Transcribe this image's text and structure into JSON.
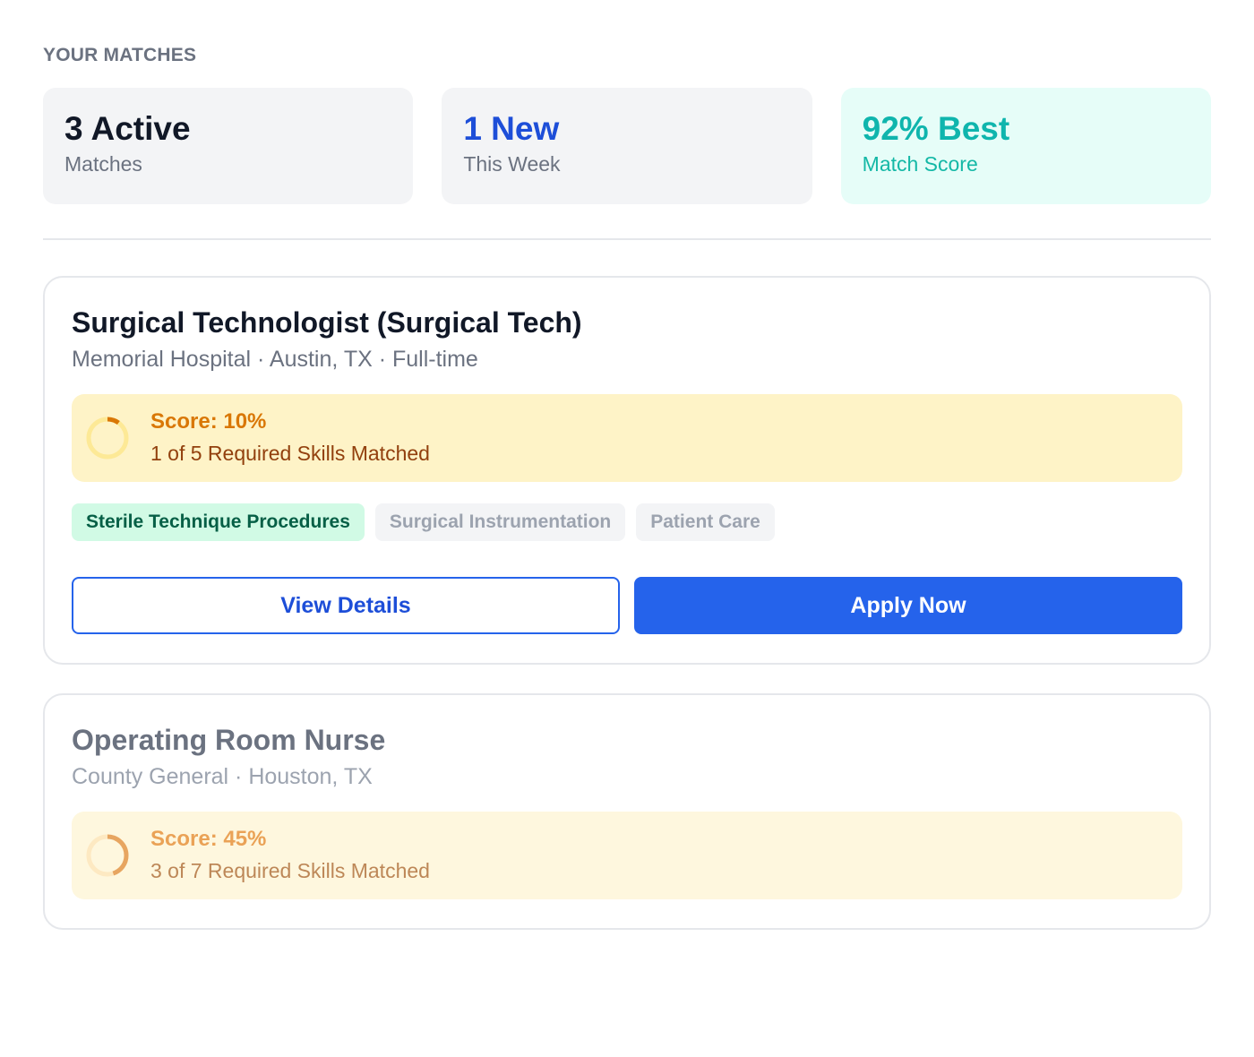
{
  "section_title": "YOUR MATCHES",
  "stats": [
    {
      "value": "3 Active",
      "label": "Matches"
    },
    {
      "value": "1 New",
      "label": "This Week"
    },
    {
      "value": "92% Best",
      "label": "Match Score"
    }
  ],
  "jobs": [
    {
      "title": "Surgical Technologist (Surgical Tech)",
      "meta": "Memorial Hospital · Austin, TX · Full-time",
      "score_label": "Score: 10%",
      "score_value": 10,
      "skills_matched_label": "1 of 5 Required Skills Matched",
      "skills": [
        {
          "name": "Sterile Technique Procedures",
          "matched": true
        },
        {
          "name": "Surgical Instrumentation",
          "matched": false
        },
        {
          "name": "Patient Care",
          "matched": false
        }
      ],
      "view_label": "View Details",
      "apply_label": "Apply Now"
    },
    {
      "title": "Operating Room Nurse",
      "meta": "County General · Houston, TX",
      "score_label": "Score: 45%",
      "score_value": 45,
      "skills_matched_label": "3 of 7 Required Skills Matched"
    }
  ],
  "colors": {
    "primary": "#2563eb",
    "teal": "#0fb5ad",
    "warning": "#d97706",
    "matched_chip": "#d1fae5"
  }
}
